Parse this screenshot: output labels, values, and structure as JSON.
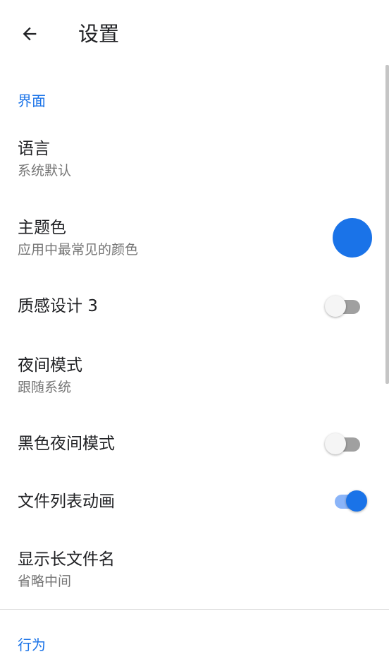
{
  "appbar": {
    "title": "设置",
    "back_icon": "arrow-back-icon"
  },
  "sections": [
    {
      "header": "界面",
      "items": [
        {
          "title": "语言",
          "summary": "系统默认"
        },
        {
          "title": "主题色",
          "summary": "应用中最常见的颜色",
          "color": "#1a73e8"
        },
        {
          "title": "质感设计 3",
          "switch_on": false
        },
        {
          "title": "夜间模式",
          "summary": "跟随系统"
        },
        {
          "title": "黑色夜间模式",
          "switch_on": false
        },
        {
          "title": "文件列表动画",
          "switch_on": true
        },
        {
          "title": "显示长文件名",
          "summary": "省略中间"
        }
      ]
    },
    {
      "header": "行为",
      "items": []
    }
  ],
  "colors": {
    "accent": "#1a73e8",
    "text_primary": "#202124",
    "text_secondary": "#757575"
  }
}
